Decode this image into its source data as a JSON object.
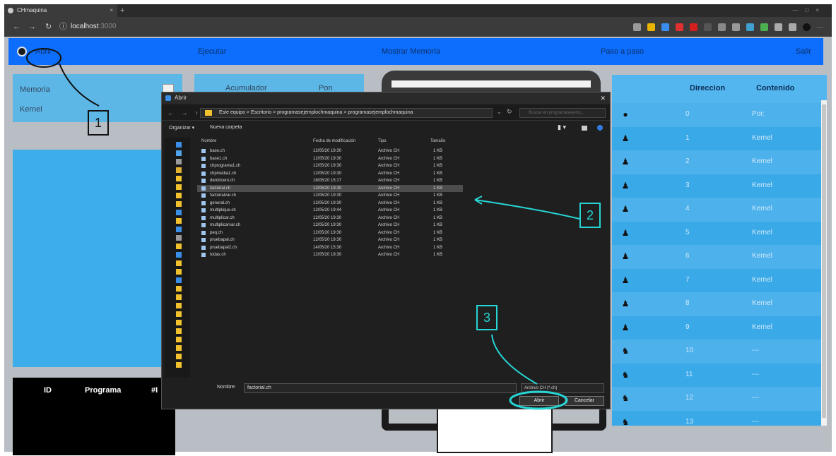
{
  "browser": {
    "tab_title": "CHmaquina",
    "url_host": "localhost",
    "url_port": ":3000"
  },
  "navbar": {
    "open": "Abrir",
    "run": "Ejecutar",
    "show_memory": "Mostrar Memoria",
    "step": "Paso a paso",
    "exit": "Salir"
  },
  "left": {
    "memoria_label": "Memoria",
    "kernel_label": "Kernel",
    "acumulador_label": "Acumulador",
    "acumulador_value": "Pon"
  },
  "program_table": {
    "headers": [
      "ID",
      "Programa",
      "#I"
    ]
  },
  "memory_table": {
    "headers": [
      "Direccion",
      "Contenido"
    ],
    "rows": [
      {
        "icon": "os-logo-icon",
        "dir": "0",
        "content": "Por:"
      },
      {
        "icon": "linux-tux-icon",
        "dir": "1",
        "content": "Kernel"
      },
      {
        "icon": "linux-tux-icon",
        "dir": "2",
        "content": "Kernel"
      },
      {
        "icon": "linux-tux-icon",
        "dir": "3",
        "content": "Kernel"
      },
      {
        "icon": "linux-tux-icon",
        "dir": "4",
        "content": "Kernel"
      },
      {
        "icon": "linux-tux-icon",
        "dir": "5",
        "content": "Kernel"
      },
      {
        "icon": "linux-tux-icon",
        "dir": "6",
        "content": "Kernel"
      },
      {
        "icon": "linux-tux-icon",
        "dir": "7",
        "content": "Kernel"
      },
      {
        "icon": "linux-tux-icon",
        "dir": "8",
        "content": "Kernel"
      },
      {
        "icon": "linux-tux-icon",
        "dir": "9",
        "content": "Kernel"
      },
      {
        "icon": "gnu-icon",
        "dir": "10",
        "content": "---"
      },
      {
        "icon": "gnu-icon",
        "dir": "11",
        "content": "---"
      },
      {
        "icon": "gnu-icon",
        "dir": "12",
        "content": "---"
      },
      {
        "icon": "gnu-icon",
        "dir": "13",
        "content": "---"
      }
    ]
  },
  "dialog": {
    "title": "Abrir",
    "breadcrumb": "Este equipo  >  Escritorio  >  programasejemplochmaquina  >  programasejemplochmaquina",
    "search_placeholder": "Buscar en programasejemp...",
    "organize": "Organizar ▾",
    "new_folder": "Nueva carpeta",
    "columns": [
      "Nombre",
      "Fecha de modificación",
      "Tipo",
      "Tamaño"
    ],
    "files": [
      {
        "name": "base.ch",
        "date": "12/05/20 19:30",
        "type": "Archivo CH",
        "size": "1 KB"
      },
      {
        "name": "base1.ch",
        "date": "12/05/20 19:30",
        "type": "Archivo CH",
        "size": "1 KB"
      },
      {
        "name": "chprograma1.ch",
        "date": "12/05/20 19:30",
        "type": "Archivo CH",
        "size": "1 KB"
      },
      {
        "name": "chpmedia1.ch",
        "date": "12/05/20 19:30",
        "type": "Archivo CH",
        "size": "1 KB"
      },
      {
        "name": "dividircero.ch",
        "date": "18/05/20 15:17",
        "type": "Archivo CH",
        "size": "1 KB"
      },
      {
        "name": "factorial.ch",
        "date": "12/05/20 19:30",
        "type": "Archivo CH",
        "size": "1 KB"
      },
      {
        "name": "factorialvar.ch",
        "date": "12/05/20 19:30",
        "type": "Archivo CH",
        "size": "1 KB"
      },
      {
        "name": "general.ch",
        "date": "12/05/20 19:30",
        "type": "Archivo CH",
        "size": "1 KB"
      },
      {
        "name": "multiplique.ch",
        "date": "12/05/20 19:44",
        "type": "Archivo CH",
        "size": "1 KB"
      },
      {
        "name": "multiplicar.ch",
        "date": "12/05/20 19:30",
        "type": "Archivo CH",
        "size": "1 KB"
      },
      {
        "name": "multiplicarvar.ch",
        "date": "12/05/20 19:30",
        "type": "Archivo CH",
        "size": "1 KB"
      },
      {
        "name": "peq.ch",
        "date": "12/05/20 19:30",
        "type": "Archivo CH",
        "size": "1 KB"
      },
      {
        "name": "pruebapal.ch",
        "date": "12/05/20 19:30",
        "type": "Archivo CH",
        "size": "1 KB"
      },
      {
        "name": "pruebapal2.ch",
        "date": "14/05/20 15:30",
        "type": "Archivo CH",
        "size": "1 KB"
      },
      {
        "name": "todas.ch",
        "date": "12/05/20 19:30",
        "type": "Archivo CH",
        "size": "1 KB"
      }
    ],
    "selected_index": 5,
    "filename_label": "Nombre:",
    "filename_value": "factorial.ch",
    "filetype": "Archivo CH (*.ch)",
    "open_button": "Abrir",
    "cancel_button": "Cancelar"
  },
  "annotations": {
    "callout_1": "1",
    "callout_2": "2",
    "callout_3": "3"
  },
  "colors": {
    "navbar": "#0d6efd",
    "panel": "#5cb7e7",
    "memory_table": "#3aa9e8",
    "callout_cyan": "#27d5d5"
  }
}
